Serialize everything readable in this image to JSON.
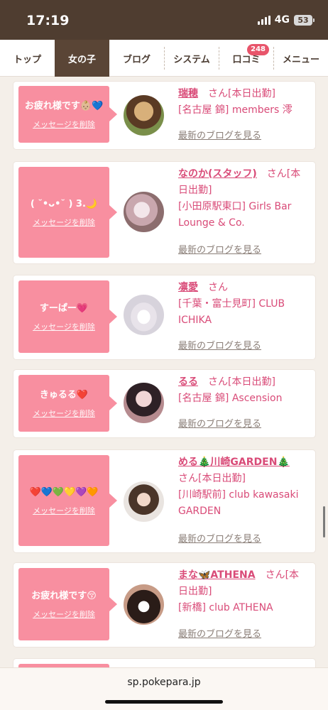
{
  "status": {
    "time": "17:19",
    "network": "4G",
    "battery": "53"
  },
  "nav": {
    "tabs": [
      {
        "label": "トップ"
      },
      {
        "label": "女の子"
      },
      {
        "label": "ブログ"
      },
      {
        "label": "システム"
      },
      {
        "label": "口コミ",
        "badge": "248"
      },
      {
        "label": "メニュー"
      }
    ]
  },
  "delete_label": "メッセージを削除",
  "blog_label": "最新のブログを見る",
  "san": "さん",
  "cards": [
    {
      "message": "お疲れ様です👶🏼💙",
      "name": "瑞穂",
      "line1_after": "[本日出勤]",
      "lines": [
        "[名古屋 錦] members 澪"
      ]
    },
    {
      "message": "( ˘•ᴗ•˘ ) 3.🌙",
      "name": "なのか(スタッフ)",
      "line1_after": "[本",
      "lines": [
        "日出勤]",
        "[小田原駅東口] Girls Bar",
        "Lounge & Co."
      ]
    },
    {
      "message": "すーぱー💗",
      "name": "凛愛",
      "line1_after": "",
      "lines": [
        "[千葉・富士見町] CLUB",
        "ICHIKA"
      ]
    },
    {
      "message": "きゅるる❤️",
      "name": "るる",
      "line1_after": "[本日出勤]",
      "lines": [
        "[名古屋 錦] Ascension"
      ]
    },
    {
      "message": "❤️💙💚💛💜🧡",
      "name": "める🎄川崎GARDEN🎄",
      "line1_after": "",
      "lines": [
        "さん[本日出勤]",
        "[川崎駅前] club kawasaki",
        "GARDEN"
      ]
    },
    {
      "message": "お疲れ様です😚",
      "name": "まな🦋ATHENA",
      "line1_after": "[本",
      "lines": [
        "日出勤]",
        "[新橋] club ATHENA"
      ]
    }
  ],
  "url": "sp.pokepara.jp"
}
